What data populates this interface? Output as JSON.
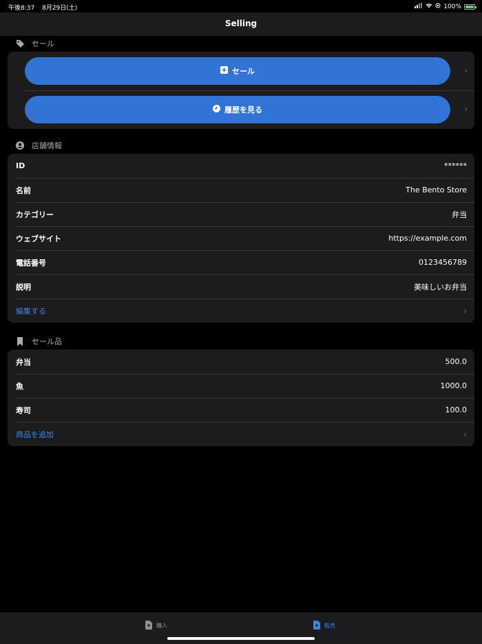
{
  "status_bar": {
    "time": "午後8:37",
    "date": "8月29日(土)",
    "battery": "100%"
  },
  "nav": {
    "title": "Selling"
  },
  "sale_section": {
    "header": "セール",
    "sale_button": "セール",
    "history_button": "履歴を見る"
  },
  "store_section": {
    "header": "店舗情報",
    "rows": [
      {
        "label": "ID",
        "value": "******"
      },
      {
        "label": "名前",
        "value": "The Bento Store"
      },
      {
        "label": "カテゴリー",
        "value": "弁当"
      },
      {
        "label": "ウェブサイト",
        "value": "https://example.com"
      },
      {
        "label": "電話番号",
        "value": "0123456789"
      },
      {
        "label": "説明",
        "value": "美味しいお弁当"
      }
    ],
    "edit_link": "編集する"
  },
  "items_section": {
    "header": "セール品",
    "rows": [
      {
        "label": "弁当",
        "value": "500.0"
      },
      {
        "label": "魚",
        "value": "1000.0"
      },
      {
        "label": "寿司",
        "value": "100.0"
      }
    ],
    "add_link": "商品を追加"
  },
  "tabs": [
    {
      "label": "購入",
      "active": false
    },
    {
      "label": "販売",
      "active": true
    }
  ],
  "colors": {
    "accent": "#3d84e0",
    "button": "#3174d6",
    "background": "#000000",
    "group": "#1c1c1e"
  }
}
